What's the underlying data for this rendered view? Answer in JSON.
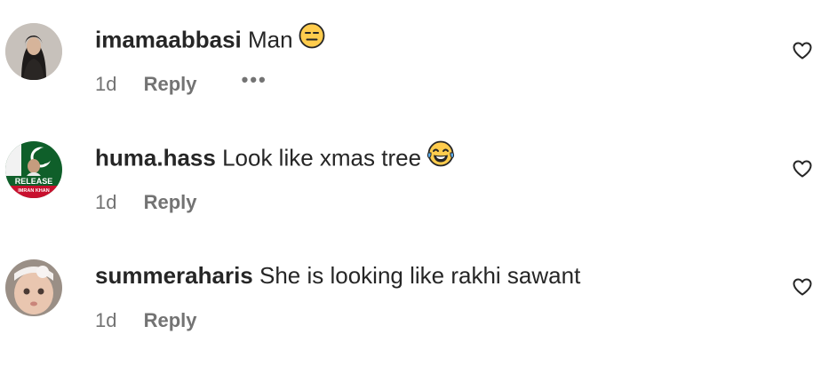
{
  "comments": [
    {
      "username": "imamaabbasi",
      "text": "Man",
      "emoji": "expressionless-face",
      "time": "1d",
      "reply": "Reply",
      "more": "•••",
      "avatar": "profile-photo"
    },
    {
      "username": "huma.hass",
      "text": "Look like xmas tree",
      "emoji": "face-with-tears-of-joy",
      "time": "1d",
      "reply": "Reply",
      "avatar": "release-imran-khan-badge",
      "avatar_text": [
        "RELEASE",
        "IMRAN KHAN"
      ]
    },
    {
      "username": "summeraharis",
      "text": "She is looking like rakhi sawant",
      "time": "1d",
      "reply": "Reply",
      "avatar": "baby-photo"
    }
  ],
  "icons": {
    "like": "heart-outline-icon"
  },
  "colors": {
    "text": "#262626",
    "secondary": "#737373",
    "emoji_yellow": "#FFCC4D",
    "emoji_outline": "#262626",
    "badge_green": "#0f5f2a",
    "badge_red": "#c8102e"
  }
}
